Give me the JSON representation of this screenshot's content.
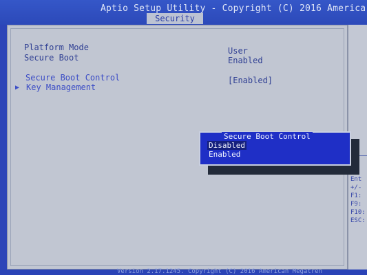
{
  "header": {
    "title": "Aptio Setup Utility - Copyright (C) 2016 America",
    "active_tab": "Security"
  },
  "main": {
    "info_rows": [
      {
        "label": "Platform Mode",
        "value": "User"
      },
      {
        "label": "Secure Boot",
        "value": "Enabled"
      }
    ],
    "settings": [
      {
        "label": "Secure Boot Control",
        "value": "[Enabled]"
      },
      {
        "label": "Key Management"
      }
    ]
  },
  "popup": {
    "title": "Secure Boot Control",
    "options": [
      "Disabled",
      "Enabled"
    ],
    "highlighted": "Disabled"
  },
  "help_panel": {
    "lines": [
      "++",
      "Ent",
      "+/-",
      "F1:",
      "F9:",
      "F10:",
      "ESC:"
    ]
  },
  "footer": {
    "text": "Version 2.17.1245. Copyright (C) 2016 American Megatren"
  },
  "colors": {
    "background_blue": "#2d45b8",
    "panel_gray": "#c1c6d2",
    "text_blue": "#2f3f93",
    "popup_blue": "#1f2fc6"
  }
}
